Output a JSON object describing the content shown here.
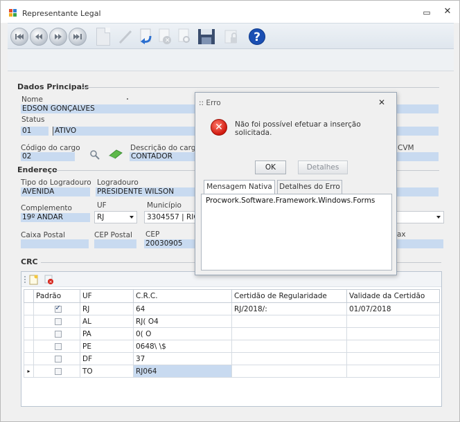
{
  "window": {
    "title": "Representante Legal",
    "minimize_glyph": "▭",
    "close_glyph": "✕"
  },
  "toolbar": {
    "buttons": [
      {
        "icon": "first-record-icon"
      },
      {
        "icon": "previous-record-icon"
      },
      {
        "icon": "next-record-icon"
      },
      {
        "icon": "last-record-icon"
      },
      {
        "icon": "new-document-icon"
      },
      {
        "icon": "edit-icon"
      },
      {
        "icon": "undo-icon"
      },
      {
        "icon": "delete-icon"
      },
      {
        "icon": "search-record-icon"
      },
      {
        "icon": "save-icon"
      },
      {
        "icon": "lock-icon"
      },
      {
        "icon": "help-icon",
        "glyph": "?"
      }
    ]
  },
  "dados_principais": {
    "section_title": "Dados Principais",
    "nome_label": "Nome",
    "nome_value": "EDSON GONÇALVES",
    "status_label": "Status",
    "status_code": "01",
    "status_value": "ATIVO",
    "codigo_cargo_label": "Código do cargo",
    "codigo_cargo_value": "02",
    "descricao_cargo_label": "Descrição do cargo",
    "descricao_cargo_value": "CONTADOR",
    "cvm_label": "CVM"
  },
  "endereco": {
    "section_title": "Endereço",
    "tipo_logradouro_label": "Tipo do Logradouro",
    "tipo_logradouro_value": "AVENIDA",
    "logradouro_label": "Logradouro",
    "logradouro_value": "PRESIDENTE WILSON",
    "complemento_label": "Complemento",
    "complemento_value": "19º ANDAR",
    "uf_label": "UF",
    "uf_value": "RJ",
    "municipio_label": "Município",
    "municipio_value": "3304557 | RIO",
    "caixa_postal_label": "Caixa Postal",
    "cep_postal_label": "CEP Postal",
    "cep_label": "CEP",
    "cep_value": "20030905",
    "fax_label": "ax"
  },
  "crc": {
    "section_title": "CRC",
    "columns": [
      "Padrão",
      "UF",
      "C.R.C.",
      "Certidão de Regularidade",
      "Validade da Certidão"
    ],
    "rows": [
      {
        "padrao": true,
        "uf": "RJ",
        "crc": "64",
        "certidao": "RJ/2018/:",
        "validade": "01/07/2018",
        "current": false
      },
      {
        "padrao": false,
        "uf": "AL",
        "crc": "RJ(      O4",
        "certidao": "",
        "validade": "",
        "current": false
      },
      {
        "padrao": false,
        "uf": "PA",
        "crc": "0(        O",
        "certidao": "",
        "validade": "",
        "current": false
      },
      {
        "padrao": false,
        "uf": "PE",
        "crc": "0648\\       \\$",
        "certidao": "",
        "validade": "",
        "current": false
      },
      {
        "padrao": false,
        "uf": "DF",
        "crc": "           37",
        "certidao": "",
        "validade": "",
        "current": false
      },
      {
        "padrao": false,
        "uf": "TO",
        "crc": "RJ064",
        "certidao": "",
        "validade": "",
        "current": true
      }
    ],
    "row_pointer_glyph": "▸"
  },
  "dialog": {
    "title": ":: Erro",
    "close_glyph": "✕",
    "message": "Não foi possível efetuar a inserção solicitada.",
    "ok_label": "OK",
    "details_label": "Detalhes",
    "tab_native": "Mensagem Nativa",
    "tab_details": "Detalhes do Erro",
    "native_message": "Procwork.Software.Framework.Windows.Forms"
  },
  "colors": {
    "field_bg": "#c8daf0",
    "error_red": "#d0180e",
    "help_blue": "#1b4fb3"
  }
}
